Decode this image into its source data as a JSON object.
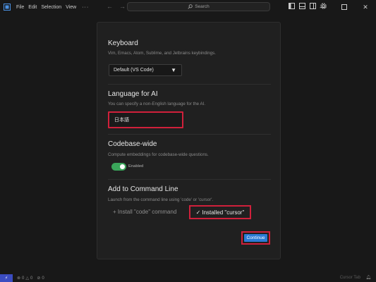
{
  "titlebar": {
    "menus": [
      {
        "label": "File"
      },
      {
        "label": "Edit"
      },
      {
        "label": "Selection"
      },
      {
        "label": "View"
      }
    ],
    "more_label": "···",
    "search_placeholder": "Search"
  },
  "dialog": {
    "keyboard": {
      "title": "Keyboard",
      "description": "Vim, Emacs, Atom, Sublime, and Jetbrains keybindings.",
      "selected": "Default (VS Code)"
    },
    "language": {
      "title": "Language for AI",
      "description": "You can specify a non-English language for the AI.",
      "value": "日本語"
    },
    "codebase": {
      "title": "Codebase-wide",
      "description": "Compute embeddings for codebase-wide questions.",
      "toggle_label": "Enabled",
      "enabled": true
    },
    "command_line": {
      "title": "Add to Command Line",
      "description": "Launch from the command line using 'code' or 'cursor'.",
      "install_code": "+ Install \"code\" command",
      "install_cursor": "Installed \"cursor\"",
      "check": "✓"
    },
    "continue_label": "Continue"
  },
  "statusbar": {
    "errors": "0",
    "warnings": "0",
    "ports": "0",
    "right_text": "Cursor Tab"
  },
  "colors": {
    "accent": "#2a7bd6",
    "highlight": "#d0203b",
    "toggle_on": "#3aa55a"
  }
}
